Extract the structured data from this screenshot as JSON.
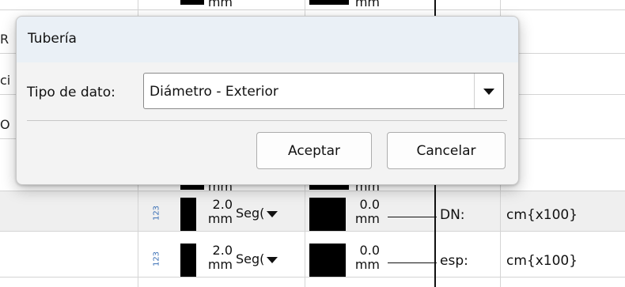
{
  "background": {
    "rows": [
      {
        "unit_top": "mm",
        "unit_top2": "mm"
      },
      {
        "value_left": "2.0",
        "unit_left": "mm",
        "combo": "Seg(",
        "value_right": "0.0",
        "unit_right": "mm",
        "label": "DN:",
        "type": "cm{x100}",
        "icon": "123"
      },
      {
        "value_left": "2.0",
        "unit_left": "mm",
        "combo": "Seg(",
        "value_right": "0.0",
        "unit_right": "mm",
        "label": "esp:",
        "type": "cm{x100}",
        "icon": "123"
      }
    ],
    "mid_units": {
      "left": "mm",
      "right": "mm"
    },
    "edge_chars": [
      "R",
      "ci",
      "O"
    ],
    "colors": {
      "grid": "#d4d4d4",
      "shade": "#efefef",
      "icon": "#3a6fb5"
    }
  },
  "dialog": {
    "title": "Tubería",
    "field_label": "Tipo de dato:",
    "select_value": "Diámetro - Exterior",
    "ok_label": "Aceptar",
    "cancel_label": "Cancelar",
    "colors": {
      "titlebar": "#eaf0f6",
      "body": "#f3f3f3"
    }
  }
}
